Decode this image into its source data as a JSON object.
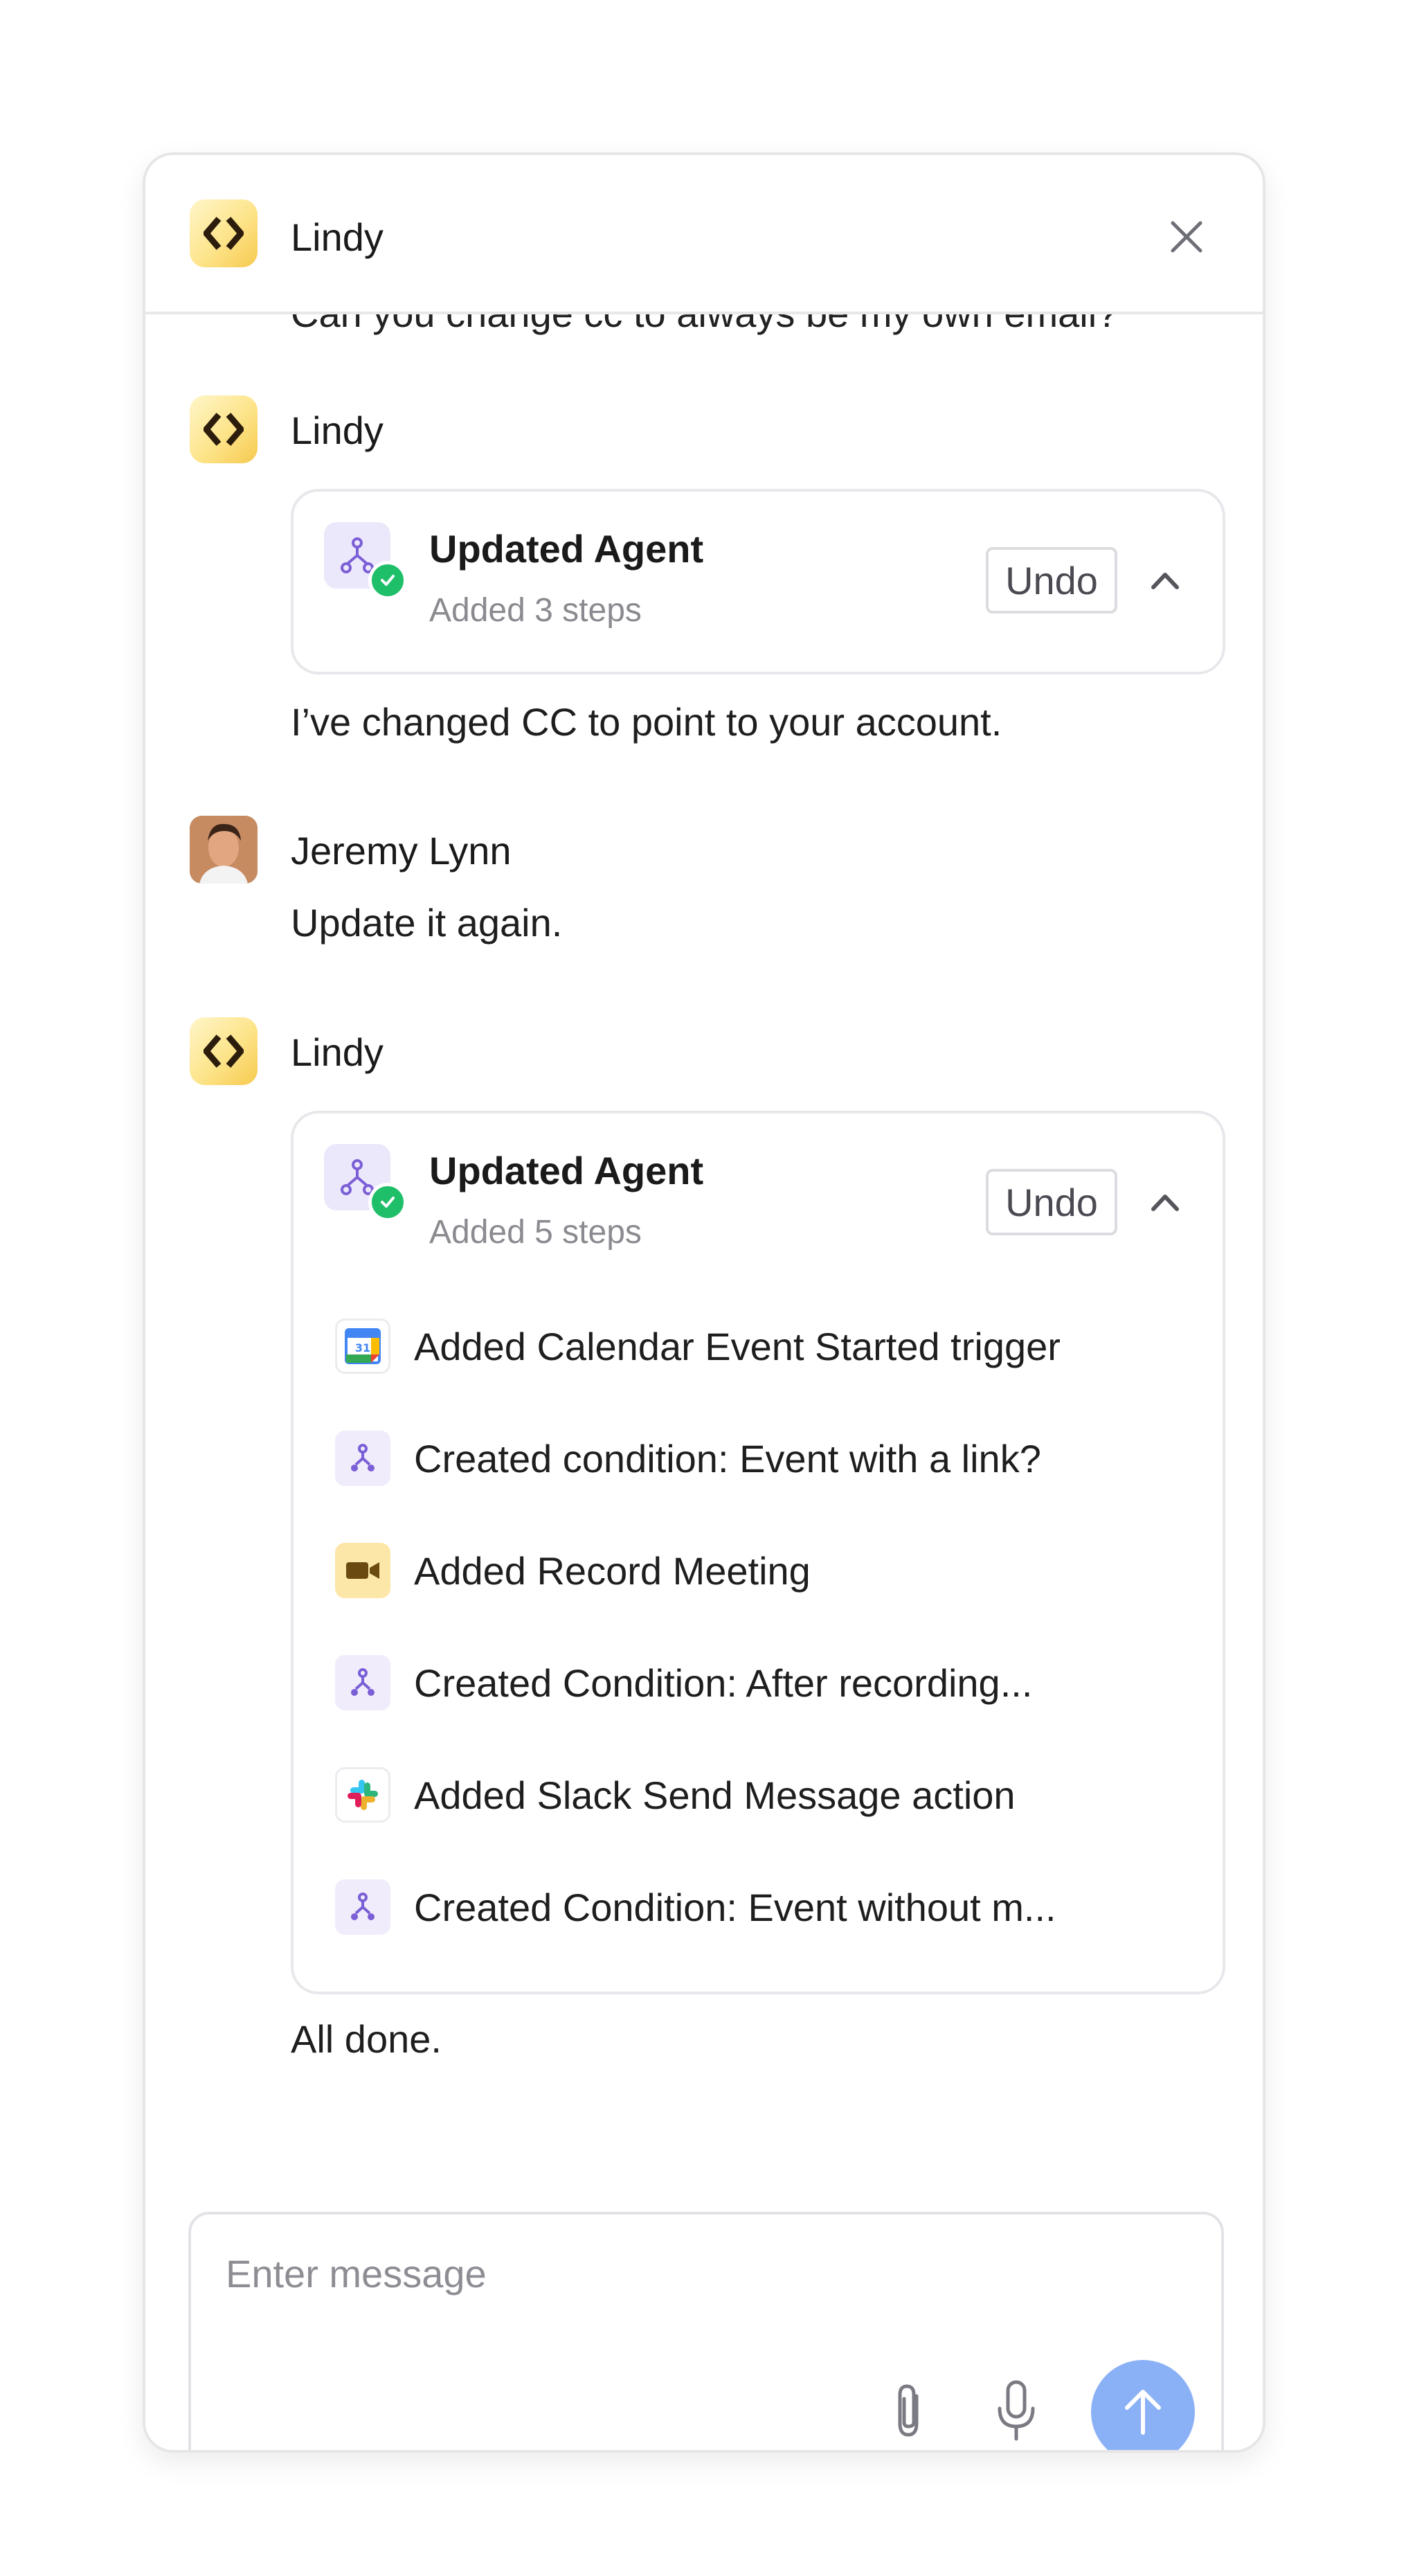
{
  "header": {
    "title": "Lindy",
    "logo_icon": "lindy-logo-icon",
    "close_icon": "close-icon"
  },
  "conversation": {
    "cut_off_text": "Can you change cc to always be my own email?",
    "messages": [
      {
        "sender": "Lindy",
        "card": {
          "title": "Updated Agent",
          "subtitle": "Added 3 steps",
          "undo_label": "Undo"
        },
        "text": "I’ve changed CC to point to your account."
      },
      {
        "sender": "Jeremy Lynn",
        "text": "Update it again."
      },
      {
        "sender": "Lindy",
        "card": {
          "title": "Updated Agent",
          "subtitle": "Added 5 steps",
          "undo_label": "Undo",
          "steps": [
            {
              "icon": "google-calendar-icon",
              "label": "Added Calendar Event Started trigger"
            },
            {
              "icon": "condition-icon",
              "label": "Created condition: Event with a link?"
            },
            {
              "icon": "record-meeting-icon",
              "label": "Added Record Meeting"
            },
            {
              "icon": "condition-icon",
              "label": "Created Condition: After recording..."
            },
            {
              "icon": "slack-icon",
              "label": "Added Slack Send Message action"
            },
            {
              "icon": "condition-icon",
              "label": "Created Condition: Event without m..."
            }
          ]
        },
        "text": "All done."
      }
    ]
  },
  "composer": {
    "placeholder": "Enter message",
    "value": "",
    "send_color": "#8ab0f6"
  },
  "colors": {
    "accent_purple": "#7b5fd6",
    "success_green": "#1fbf6a",
    "logo_yellow": "#f6c94e"
  }
}
